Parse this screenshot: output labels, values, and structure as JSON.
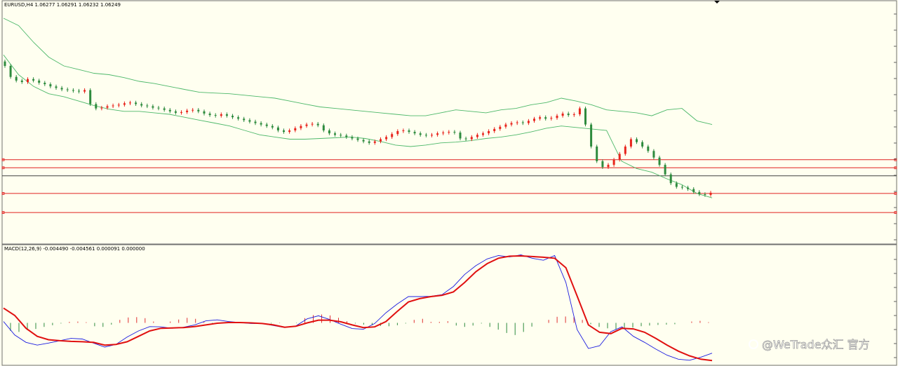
{
  "price_header": "EURUSD,H4  1.06277 1.06291 1.06232 1.06249",
  "macd_header": "MACD(12,26,9) -0.004490 -0.004561 0.000091 0.000000",
  "watermark": "@WeTrade众汇 官方",
  "colors": {
    "background": "#FFFFF0",
    "bull": "#E8241C",
    "bear": "#2E8B3E",
    "band": "#4DB86A",
    "level": "#E02020",
    "current_price": "#404040",
    "macd_line": "#1C1CE0",
    "signal_line": "#E01010",
    "hist_pos": "#E03030",
    "hist_neg": "#2E8B3E"
  },
  "chart_data": [
    {
      "type": "candlestick",
      "symbol": "EURUSD",
      "timeframe": "H4",
      "last_bar": {
        "open": 1.06277,
        "high": 1.06291,
        "low": 1.06232,
        "close": 1.06249
      },
      "closes": [
        1.09,
        1.0885,
        1.088,
        1.0878,
        1.0882,
        1.088,
        1.0877,
        1.0875,
        1.0872,
        1.087,
        1.0868,
        1.0867,
        1.0866,
        1.0865,
        1.0867,
        1.0848,
        1.0842,
        1.0843,
        1.0845,
        1.0846,
        1.0847,
        1.0849,
        1.085,
        1.0848,
        1.0846,
        1.0845,
        1.0843,
        1.0842,
        1.084,
        1.0838,
        1.0836,
        1.0837,
        1.0839,
        1.084,
        1.0838,
        1.0835,
        1.0833,
        1.0832,
        1.0834,
        1.0832,
        1.083,
        1.0828,
        1.0826,
        1.0824,
        1.0822,
        1.082,
        1.0818,
        1.0816,
        1.0812,
        1.081,
        1.0812,
        1.0815,
        1.0818,
        1.082,
        1.0821,
        1.0819,
        1.0812,
        1.0808,
        1.0806,
        1.0805,
        1.0803,
        1.0801,
        1.0799,
        1.0797,
        1.0795,
        1.0797,
        1.08,
        1.0803,
        1.0807,
        1.0811,
        1.0812,
        1.081,
        1.0808,
        1.0806,
        1.0805,
        1.0806,
        1.0808,
        1.0809,
        1.081,
        1.0809,
        1.0801,
        1.08,
        1.0803,
        1.0806,
        1.0808,
        1.0811,
        1.0814,
        1.0817,
        1.082,
        1.0822,
        1.0823,
        1.0822,
        1.0825,
        1.0828,
        1.083,
        1.0828,
        1.0829,
        1.0832,
        1.0835,
        1.0833,
        1.0834,
        1.0842,
        1.082,
        1.079,
        1.077,
        1.0762,
        1.0765,
        1.0772,
        1.078,
        1.079,
        1.08,
        1.0796,
        1.079,
        1.0784,
        1.0775,
        1.0765,
        1.0752,
        1.074,
        1.0735,
        1.0734,
        1.0732,
        1.0728,
        1.0725,
        1.0724,
        1.0727
      ],
      "bands": {
        "upper": [
          1.0965,
          1.0955,
          1.0932,
          1.0912,
          1.09,
          1.0895,
          1.089,
          1.0888,
          1.0884,
          1.0879,
          1.0876,
          1.0872,
          1.0868,
          1.0864,
          1.0863,
          1.0862,
          1.086,
          1.0858,
          1.0856,
          1.0852,
          1.0848,
          1.0844,
          1.0842,
          1.084,
          1.0838,
          1.0836,
          1.0834,
          1.0832,
          1.0832,
          1.0836,
          1.084,
          1.0838,
          1.0836,
          1.084,
          1.0842,
          1.0847,
          1.085,
          1.0856,
          1.0852,
          1.0847,
          1.084,
          1.0838,
          1.0836,
          1.0832,
          1.084,
          1.0842,
          1.0825,
          1.082
        ],
        "lower": [
          1.0915,
          1.0888,
          1.0872,
          1.0862,
          1.0858,
          1.0852,
          1.0846,
          1.0841,
          1.0838,
          1.0838,
          1.0836,
          1.0834,
          1.083,
          1.0826,
          1.0822,
          1.0818,
          1.0812,
          1.0806,
          1.0803,
          1.08,
          1.08,
          1.0801,
          1.0802,
          1.0803,
          1.0801,
          1.0797,
          1.0792,
          1.079,
          1.0792,
          1.0795,
          1.0796,
          1.0798,
          1.0801,
          1.0803,
          1.0806,
          1.081,
          1.0815,
          1.0818,
          1.0816,
          1.0814,
          1.0812,
          1.077,
          1.076,
          1.0755,
          1.0746,
          1.0738,
          1.0726,
          1.072
        ]
      },
      "horizontal_levels": [
        1.0772,
        1.0761,
        1.0726,
        1.07
      ],
      "current_price_level": 1.075
    },
    {
      "type": "indicator",
      "name": "MACD",
      "params": [
        12,
        26,
        9
      ],
      "values": {
        "main": -0.00449,
        "signal": -0.004561,
        "histogram": 9.1e-05,
        "extra": 0.0
      },
      "macd": [
        0.0002,
        -0.0018,
        -0.0029,
        -0.0033,
        -0.003,
        -0.00265,
        -0.0023,
        -0.0024,
        -0.003,
        -0.0036,
        -0.0032,
        -0.0021,
        -0.0012,
        -0.00055,
        -0.0006,
        -0.0008,
        -0.00065,
        -0.0003,
        0.0003,
        0.00045,
        0.0002,
        5e-05,
        -0.0001,
        -0.0001,
        -0.0004,
        -0.0007,
        -0.00045,
        0.0006,
        0.00105,
        0.0005,
        -0.0002,
        -0.00085,
        -0.00095,
        -0.0001,
        0.0015,
        0.0028,
        0.0039,
        0.0039,
        0.00395,
        0.0042,
        0.0054,
        0.0072,
        0.0085,
        0.0095,
        0.01,
        0.0098,
        0.0101,
        0.0096,
        0.0093,
        0.01,
        0.006,
        -0.001,
        -0.0038,
        -0.0034,
        -0.0013,
        -0.0006,
        -0.002,
        -0.0029,
        -0.0039,
        -0.0048,
        -0.0054,
        -0.00555,
        -0.0051,
        -0.0045
      ],
      "signal": [
        0.0022,
        0.0011,
        -0.0008,
        -0.002,
        -0.0025,
        -0.00265,
        -0.00275,
        -0.0028,
        -0.0029,
        -0.0033,
        -0.0032,
        -0.0028,
        -0.002,
        -0.0012,
        -0.0008,
        -0.00075,
        -0.0007,
        -0.00055,
        -0.0003,
        -5e-05,
        5e-05,
        5e-05,
        0.0,
        -0.0001,
        -0.0003,
        -0.00065,
        -0.0005,
        0.0,
        0.0004,
        0.0004,
        0.00015,
        -0.0003,
        -0.0007,
        -0.0006,
        0.0002,
        0.0017,
        0.0031,
        0.0036,
        0.0039,
        0.0041,
        0.0046,
        0.006,
        0.0076,
        0.0088,
        0.0096,
        0.0099,
        0.00995,
        0.00985,
        0.00975,
        0.0096,
        0.0082,
        0.004,
        -0.0003,
        -0.0014,
        -0.0016,
        -0.0008,
        -0.0009,
        -0.0014,
        -0.0023,
        -0.0033,
        -0.0042,
        -0.0049,
        -0.0054,
        -0.0056
      ],
      "histogram": [
        -0.0012,
        -0.00135,
        -0.0011,
        -0.0009,
        -0.0006,
        -0.00035,
        -0.0001,
        0.00015,
        0.0002,
        0.0001,
        -0.0005,
        -0.0006,
        -0.00025,
        0.00045,
        0.0008,
        0.00085,
        0.0007,
        0.0002,
        0.0,
        0.0002,
        0.0005,
        0.00075,
        0.0006,
        0.0002,
        -0.0001,
        -5e-05,
        5e-05,
        0.00015,
        -5e-05,
        -0.00015,
        -0.0002,
        -0.0001,
        5e-05,
        0.0,
        -5e-05,
        0.0007,
        0.00115,
        0.00125,
        0.0011,
        0.00075,
        0.00025,
        -0.0001,
        -0.00025,
        -0.00035,
        -0.00045,
        -0.0005,
        -0.00035,
        -0.0001,
        0.00045,
        0.0006,
        0.00015,
        0.00015,
        0.00025,
        -0.0004,
        -0.0006,
        -0.0004,
        -0.0001,
        -0.0006,
        -0.001,
        -0.0015,
        -0.0018,
        -0.00135,
        -0.00055,
        0.0,
        0.00045,
        0.0009,
        0.00095,
        0.00085,
        0.00045,
        -0.0002,
        -0.0006,
        -0.0008,
        -0.001,
        -0.0009,
        -0.0007,
        -0.0005,
        -0.0004,
        -0.0003,
        -0.00025,
        -0.0002,
        0.0,
        0.0002,
        0.0003,
        0.0001
      ]
    }
  ]
}
